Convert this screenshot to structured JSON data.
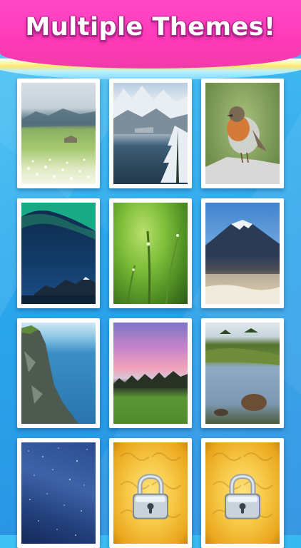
{
  "header": {
    "title": "Multiple Themes!"
  },
  "themes": [
    {
      "label": "meadow",
      "locked": false,
      "colors": [
        "#cfd8de",
        "#5a7a57",
        "#9cc36a",
        "#eef5d6"
      ]
    },
    {
      "label": "snow-mountain",
      "locked": false,
      "colors": [
        "#9db7cf",
        "#e8eef2",
        "#3d5c72",
        "#2c3f4d"
      ]
    },
    {
      "label": "robin",
      "locked": false,
      "colors": [
        "#7f9f5a",
        "#a8c07a",
        "#d27a3b",
        "#d9d9d9"
      ]
    },
    {
      "label": "aurora",
      "locked": false,
      "colors": [
        "#1bb38f",
        "#12335e",
        "#0b1d3a",
        "#5c7ea3"
      ]
    },
    {
      "label": "dew-grass",
      "locked": false,
      "colors": [
        "#2f5e1c",
        "#7fbf3a",
        "#9fd14a",
        "#3b6d1e"
      ]
    },
    {
      "label": "mount-fuji",
      "locked": false,
      "colors": [
        "#3d7cc9",
        "#e9f1f7",
        "#2c3b55",
        "#c9b59a"
      ]
    },
    {
      "label": "sea-cliff",
      "locked": false,
      "colors": [
        "#9fd4ea",
        "#2e7fb8",
        "#5b6b60",
        "#3c4a40"
      ]
    },
    {
      "label": "sunset-field",
      "locked": false,
      "colors": [
        "#b77ad0",
        "#f1a1b7",
        "#2f3c2c",
        "#5f9a35"
      ]
    },
    {
      "label": "pond",
      "locked": false,
      "colors": [
        "#b9c9d4",
        "#445f2e",
        "#8aa5bf",
        "#5d4a37"
      ]
    },
    {
      "label": "stars",
      "locked": false,
      "colors": [
        "#1c3b75",
        "#3a5fa6",
        "#6a86c4",
        "#0f2350"
      ]
    },
    {
      "label": "gold-pattern",
      "locked": true,
      "colors": [
        "#f7c846",
        "#e9a51c",
        "#ffe07a",
        "#c98612"
      ]
    },
    {
      "label": "gold-pattern",
      "locked": true,
      "colors": [
        "#f7c846",
        "#e9a51c",
        "#ffe07a",
        "#c98612"
      ]
    }
  ],
  "accent": {
    "header_pink": "#ff3ab8",
    "title_outline": "#b2258b",
    "background_blue": "#2aa7ec"
  }
}
